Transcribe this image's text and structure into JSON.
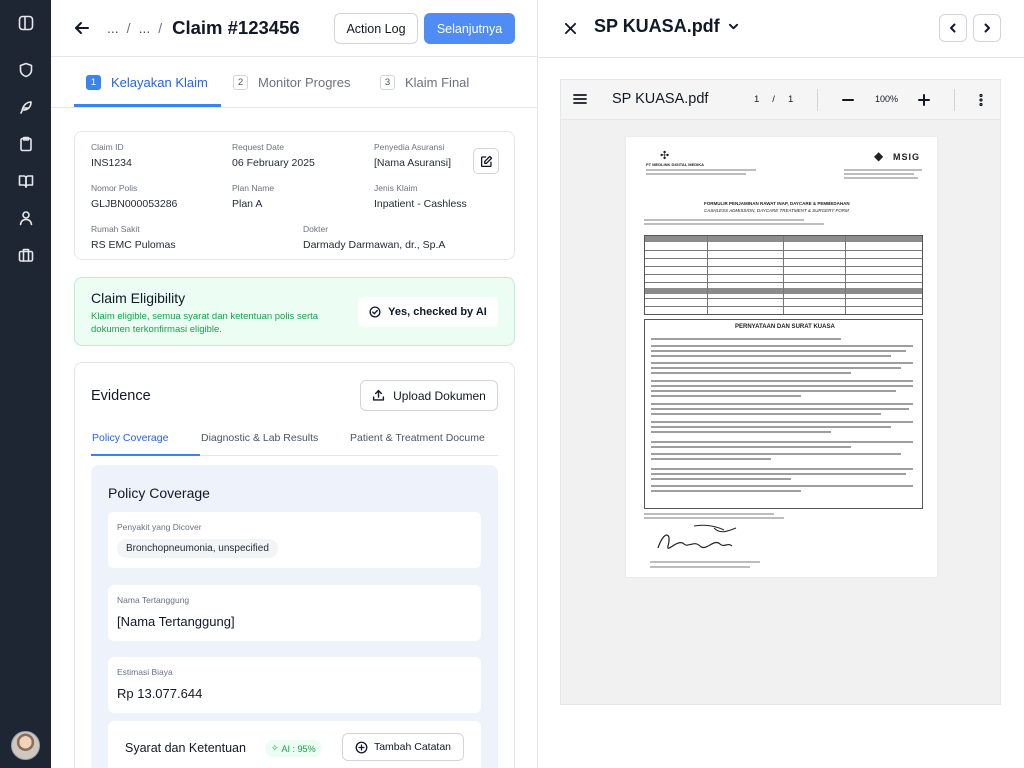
{
  "header": {
    "crumb_1": "...",
    "crumb_2": "...",
    "separator": "/",
    "title": "Claim #123456",
    "action_log_label": "Action Log",
    "next_label": "Selanjutnya"
  },
  "steps": [
    {
      "num": "1",
      "label": "Kelayakan Klaim",
      "active": true
    },
    {
      "num": "2",
      "label": "Monitor Progres",
      "active": false
    },
    {
      "num": "3",
      "label": "Klaim Final",
      "active": false
    }
  ],
  "claim_info": {
    "claim_id": {
      "label": "Claim ID",
      "value": "INS1234"
    },
    "request_date": {
      "label": "Request Date",
      "value": "06 February 2025"
    },
    "insurer": {
      "label": "Penyedia Asuransi",
      "value": "[Nama Asuransi]"
    },
    "policy_no": {
      "label": "Nomor Polis",
      "value": "GLJBN000053286"
    },
    "plan_name": {
      "label": "Plan Name",
      "value": "Plan A"
    },
    "claim_type": {
      "label": "Jenis Klaim",
      "value": "Inpatient - Cashless"
    },
    "hospital": {
      "label": "Rumah Sakit",
      "value": "RS EMC Pulomas"
    },
    "doctor": {
      "label": "Dokter",
      "value": "Darmady Darmawan, dr., Sp.A"
    }
  },
  "eligibility": {
    "title": "Claim Eligibility",
    "description": "Klaim eligible, semua syarat dan ketentuan polis serta dokumen terkonfirmasi eligible.",
    "badge": "Yes, checked by AI",
    "colors": {
      "background": "#ecfdf3",
      "text": "#16a34a"
    }
  },
  "evidence": {
    "title": "Evidence",
    "upload_label": "Upload Dokumen",
    "tabs": [
      "Policy Coverage",
      "Diagnostic & Lab Results",
      "Patient & Treatment Docume"
    ],
    "active_tab": "Policy Coverage",
    "policy_coverage": {
      "title": "Policy Coverage",
      "covered_disease": {
        "label": "Penyakit yang Dicover",
        "value": "Bronchopneumonia, unspecified"
      },
      "insured_name": {
        "label": "Nama Tertanggung",
        "value": "[Nama Tertanggung]"
      },
      "cost_estimate": {
        "label": "Estimasi Biaya",
        "value": "Rp 13.077.644"
      },
      "terms": {
        "title": "Syarat dan Ketentuan",
        "ai_score": "AI : 95%",
        "add_note_label": "Tambah Catatan"
      }
    }
  },
  "document": {
    "file_name": "SP KUASA.pdf",
    "viewer_name": "SP KUASA.pdf",
    "page_current": "1",
    "page_separator": "/",
    "page_total": "1",
    "zoom": "100%",
    "paper": {
      "brand_left": "PT MEDLINK DIGITAL MEDIKA",
      "brand_right": "MSIG",
      "form_title": "FORMULIR PENJAMINAN RAWAT INAP, DAYCARE & PEMBEDAHAN",
      "form_subtitle": "CASHLESS ADMISSION, DAYCARE TREATMENT & SURGERY FORM",
      "statement_title": "PERNYATAAN DAN SURAT KUASA"
    }
  },
  "colors": {
    "primary": "#4f8cf6",
    "rail": "#1e2533",
    "accent_text": "#2563eb"
  },
  "icons": [
    "sidebar-toggle-icon",
    "shield-icon",
    "feather-icon",
    "clipboard-icon",
    "book-icon",
    "user-icon",
    "briefcase-icon",
    "arrow-left-icon",
    "edit-icon",
    "check-circle-icon",
    "upload-icon",
    "sparkle-icon",
    "plus-circle-icon",
    "close-icon",
    "chevron-down-icon",
    "chevron-left-icon",
    "chevron-right-icon",
    "menu-icon",
    "minus-icon",
    "plus-icon",
    "more-vertical-icon"
  ]
}
